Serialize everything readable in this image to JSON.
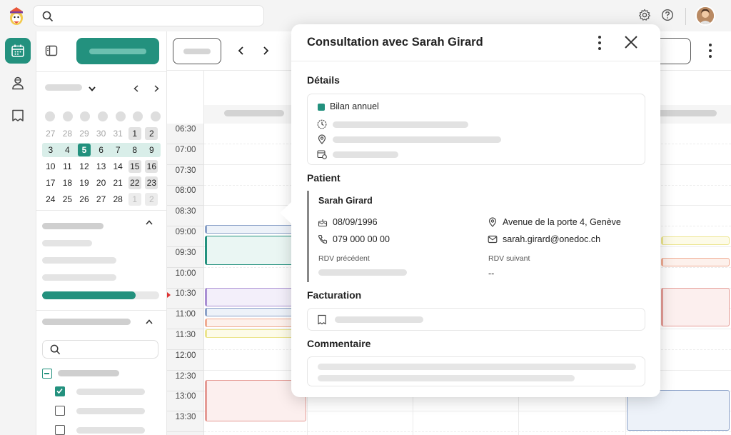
{
  "popup": {
    "title": "Consultation avec Sarah Girard",
    "details_title": "Détails",
    "appointment_type": "Bilan annuel",
    "patient_title": "Patient",
    "patient": {
      "name": "Sarah Girard",
      "birthdate": "08/09/1996",
      "phone": "079 000 00 00",
      "address": "Avenue de la porte 4, Genève",
      "email": "sarah.girard@onedoc.ch",
      "previous_appt_label": "RDV précédent",
      "next_appt_label": "RDV suivant",
      "next_appt_value": "--"
    },
    "billing_title": "Facturation",
    "comment_title": "Commentaire"
  },
  "mini_calendar": {
    "weeks": [
      [
        "27",
        "28",
        "29",
        "30",
        "31",
        "1",
        "2"
      ],
      [
        "3",
        "4",
        "5",
        "6",
        "7",
        "8",
        "9"
      ],
      [
        "10",
        "11",
        "12",
        "13",
        "14",
        "15",
        "16"
      ],
      [
        "17",
        "18",
        "19",
        "20",
        "21",
        "22",
        "23"
      ],
      [
        "24",
        "25",
        "26",
        "27",
        "28",
        "1",
        "2"
      ]
    ],
    "today": "5"
  },
  "times": [
    "06:30",
    "07:00",
    "07:30",
    "08:00",
    "08:30",
    "09:00",
    "09:30",
    "10:00",
    "10:30",
    "11:00",
    "11:30",
    "12:00",
    "12:30",
    "13:00",
    "13:30"
  ],
  "sidebar": {
    "progress_fraction": 0.8
  },
  "colors": {
    "brand": "#23917e",
    "now": "#d33333"
  }
}
